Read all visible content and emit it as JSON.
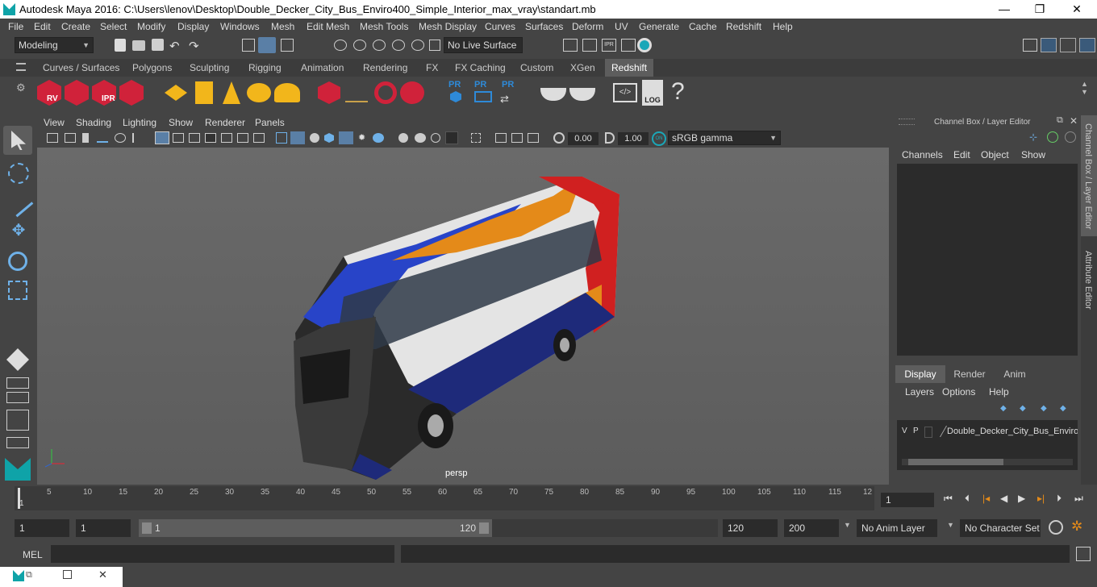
{
  "window": {
    "title": "Autodesk Maya 2016: C:\\Users\\lenov\\Desktop\\Double_Decker_City_Bus_Enviro400_Simple_Interior_max_vray\\standart.mb",
    "minimize": "—",
    "maximize": "❐",
    "close": "✕"
  },
  "menubar": [
    "File",
    "Edit",
    "Create",
    "Select",
    "Modify",
    "Display",
    "Windows",
    "Mesh",
    "Edit Mesh",
    "Mesh Tools",
    "Mesh Display",
    "Curves",
    "Surfaces",
    "Deform",
    "UV",
    "Generate",
    "Cache",
    "Redshift",
    "Help"
  ],
  "status": {
    "mode": "Modeling",
    "live_surface": "No Live Surface"
  },
  "shelf_tabs": [
    "Curves / Surfaces",
    "Polygons",
    "Sculpting",
    "Rigging",
    "Animation",
    "Rendering",
    "FX",
    "FX Caching",
    "Custom",
    "XGen",
    "Redshift"
  ],
  "shelf_active": "Redshift",
  "shelf_icon_labels": {
    "rv": "RV",
    "ipr": "IPR",
    "pr1": "PR",
    "pr2": "PR",
    "pr3": "PR",
    "log": "LOG",
    "help": "?"
  },
  "viewport": {
    "menu": [
      "View",
      "Shading",
      "Lighting",
      "Show",
      "Renderer",
      "Panels"
    ],
    "exposure": "0.00",
    "gamma": "1.00",
    "color_space": "sRGB gamma",
    "camera": "persp"
  },
  "channel_box": {
    "title": "Channel Box / Layer Editor",
    "menu": [
      "Channels",
      "Edit",
      "Object",
      "Show"
    ],
    "layer_tabs": [
      "Display",
      "Render",
      "Anim"
    ],
    "layer_tab_active": "Display",
    "layer_menu": [
      "Layers",
      "Options",
      "Help"
    ],
    "layer": {
      "v": "V",
      "p": "P",
      "name": "Double_Decker_City_Bus_Enviro"
    }
  },
  "side_tabs": [
    "Channel Box / Layer Editor",
    "Attribute Editor"
  ],
  "timeline": {
    "ticks": [
      "5",
      "10",
      "15",
      "20",
      "25",
      "30",
      "35",
      "40",
      "45",
      "50",
      "55",
      "60",
      "65",
      "70",
      "75",
      "80",
      "85",
      "90",
      "95",
      "100",
      "105",
      "110",
      "115",
      "12"
    ],
    "start_marker": "1",
    "current_frame": "1"
  },
  "range": {
    "start": "1",
    "start2": "1",
    "slider_start": "1",
    "slider_end": "120",
    "end": "120",
    "end2": "200",
    "anim_layer": "No Anim Layer",
    "character_set": "No Character Set"
  },
  "command": {
    "label": "MEL"
  },
  "colors": {
    "accent": "#0fa3a8",
    "active_tab": "#5d5d5d",
    "redshift_red": "#d0223a",
    "shelf_yellow": "#f2b61b",
    "pr_blue": "#2e8ad8"
  }
}
